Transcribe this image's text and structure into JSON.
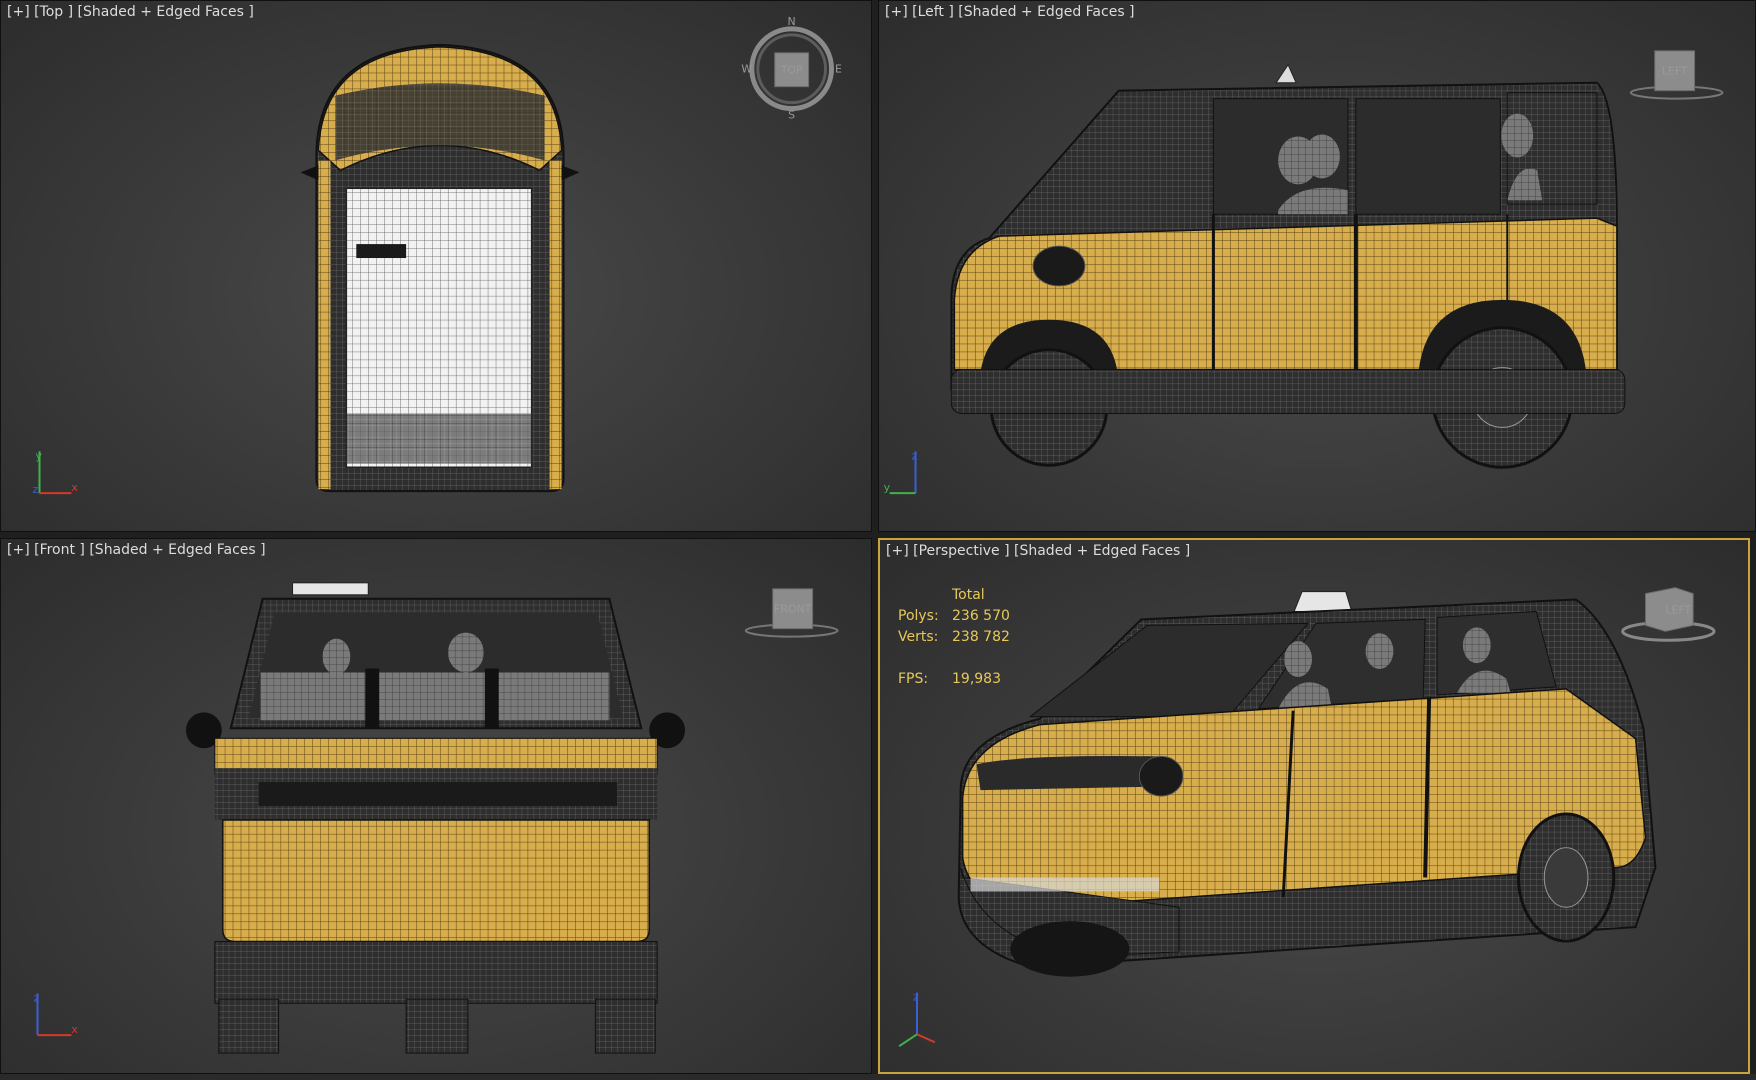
{
  "viewports": {
    "top": {
      "label": "[+] [Top ] [Shaded + Edged Faces ]",
      "viewcube": "TOP"
    },
    "left": {
      "label": "[+] [Left ] [Shaded + Edged Faces ]",
      "viewcube": "LEFT"
    },
    "front": {
      "label": "[+] [Front ] [Shaded + Edged Faces ]",
      "viewcube": "FRONT"
    },
    "perspective": {
      "label": "[+] [Perspective ] [Shaded + Edged Faces ]",
      "viewcube": "LEFT",
      "stats": {
        "header": "Total",
        "polys_label": "Polys:",
        "polys": "236 570",
        "verts_label": "Verts:",
        "verts": "238 782",
        "fps_label": "FPS:",
        "fps": "19,983"
      }
    }
  },
  "colors": {
    "taxi_yellow": "#d8ad4c",
    "active_border": "#c9a33c",
    "stats_text": "#e8c85a",
    "axis_x": "#d23a2a",
    "axis_y": "#3fb34a",
    "axis_z": "#3a5fd8"
  },
  "axis_tripods": {
    "top": [
      "y",
      "z",
      "x"
    ],
    "left": [
      "z",
      "y"
    ],
    "front": [
      "z",
      "x"
    ],
    "perspective": [
      "z",
      "y"
    ]
  }
}
